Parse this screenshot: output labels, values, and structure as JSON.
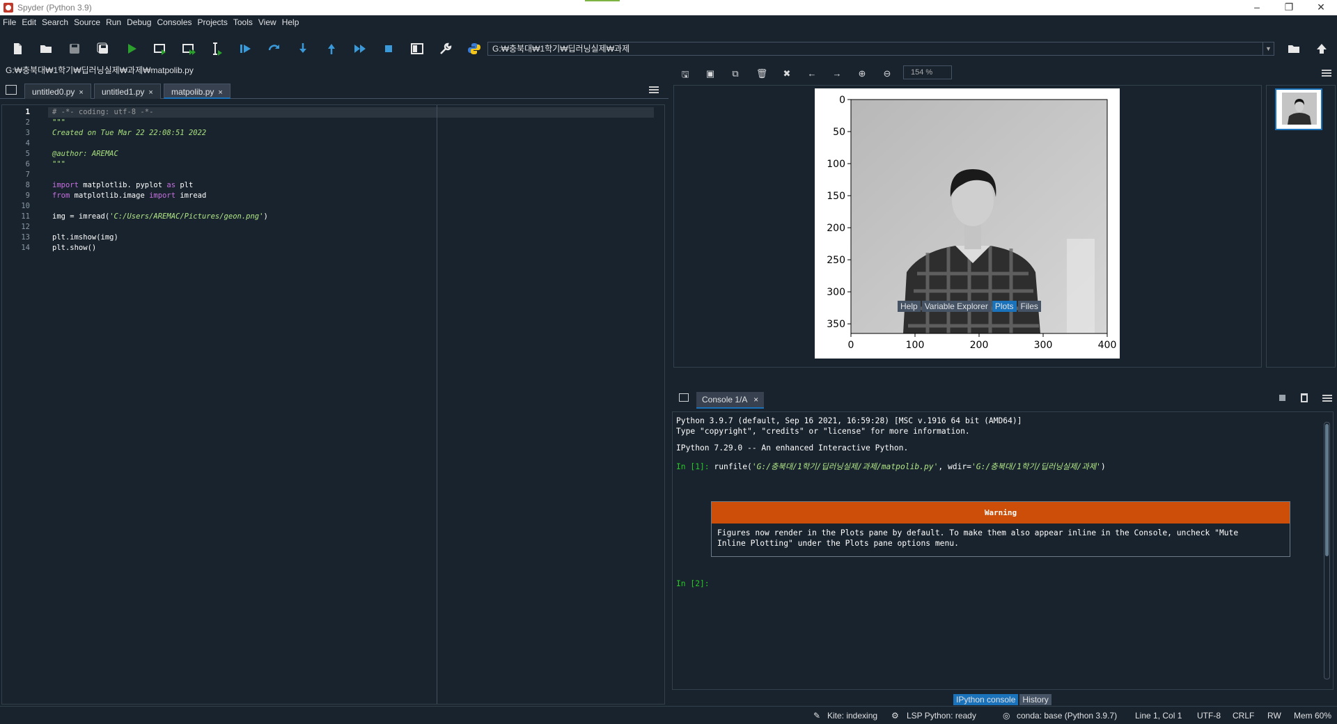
{
  "window": {
    "title": "Spyder (Python 3.9)"
  },
  "menu": [
    "File",
    "Edit",
    "Search",
    "Source",
    "Run",
    "Debug",
    "Consoles",
    "Projects",
    "Tools",
    "View",
    "Help"
  ],
  "toolbar": {
    "path": "G:₩충북대₩1학기₩딥러닝실제₩과제",
    "icons": [
      "new-file-icon",
      "open-file-icon",
      "save-icon",
      "save-all-icon",
      "run-icon",
      "run-cell-icon",
      "run-cell-advance-icon",
      "run-selection-icon",
      "debug-icon",
      "step-over-icon",
      "step-into-icon",
      "step-return-icon",
      "continue-icon",
      "stop-icon",
      "maximize-pane-icon",
      "preferences-icon",
      "python-path-icon"
    ]
  },
  "editor": {
    "filepath": "G:₩충북대₩1학기₩딥러닝실제₩과제₩matpolib.py",
    "tabs": [
      {
        "label": "untitled0.py",
        "close": "×"
      },
      {
        "label": "untitled1.py",
        "close": "×"
      },
      {
        "label": "matpolib.py",
        "close": "×"
      }
    ],
    "lines": [
      {
        "n": "1",
        "segs": [
          {
            "t": "# -*- coding: utf-8 -*-",
            "c": "cm"
          }
        ]
      },
      {
        "n": "2",
        "segs": [
          {
            "t": "\"\"\"",
            "c": "ds"
          }
        ]
      },
      {
        "n": "3",
        "segs": [
          {
            "t": "Created on Tue Mar 22 22:08:51 2022",
            "c": "ds"
          }
        ]
      },
      {
        "n": "4",
        "segs": []
      },
      {
        "n": "5",
        "segs": [
          {
            "t": "@author: AREMAC",
            "c": "ds"
          }
        ]
      },
      {
        "n": "6",
        "segs": [
          {
            "t": "\"\"\"",
            "c": "ds"
          }
        ]
      },
      {
        "n": "7",
        "segs": []
      },
      {
        "n": "8",
        "segs": [
          {
            "t": "import",
            "c": "kw"
          },
          {
            "t": " matplotlib. pyplot ",
            "c": ""
          },
          {
            "t": "as",
            "c": "kw"
          },
          {
            "t": " plt",
            "c": ""
          }
        ]
      },
      {
        "n": "9",
        "segs": [
          {
            "t": "from",
            "c": "kw"
          },
          {
            "t": " matplotlib.image ",
            "c": ""
          },
          {
            "t": "import",
            "c": "kw"
          },
          {
            "t": " imread",
            "c": ""
          }
        ]
      },
      {
        "n": "10",
        "segs": []
      },
      {
        "n": "11",
        "segs": [
          {
            "t": "img = imread(",
            "c": ""
          },
          {
            "t": "'C:/Users/AREMAC/Pictures/geon.png'",
            "c": "str"
          },
          {
            "t": ")",
            "c": ""
          }
        ]
      },
      {
        "n": "12",
        "segs": []
      },
      {
        "n": "13",
        "segs": [
          {
            "t": "plt.imshow(img)",
            "c": ""
          }
        ]
      },
      {
        "n": "14",
        "segs": [
          {
            "t": "plt.show()",
            "c": ""
          }
        ]
      }
    ]
  },
  "plots": {
    "zoom": "154 %",
    "x_ticks": [
      "0",
      "100",
      "200",
      "300",
      "400"
    ],
    "y_ticks": [
      "0",
      "50",
      "100",
      "150",
      "200",
      "250",
      "300",
      "350"
    ],
    "tabs": [
      "Help",
      "Variable Explorer",
      "Plots",
      "Files"
    ],
    "active_tab": "Plots"
  },
  "console": {
    "tab_label": "Console 1/A",
    "tab_close": "×",
    "line1": "Python 3.9.7 (default, Sep 16 2021, 16:59:28) [MSC v.1916 64 bit (AMD64)]",
    "line2": "Type \"copyright\", \"credits\" or \"license\" for more information.",
    "line3": "IPython 7.29.0 -- An enhanced Interactive Python.",
    "prompt1": "In [1]:",
    "cmd_a": " runfile(",
    "cmd_b": "'G:/충북대/1학기/딥러닝실제/과제/matpolib.py'",
    "cmd_c": ", wdir=",
    "cmd_d": "'G:/충북대/1학기/딥러닝실제/과제'",
    "cmd_e": ")",
    "warning_title": "Warning",
    "warning_text": "Figures now render in the Plots pane by default. To make them also appear inline in the Console, uncheck \"Mute\nInline Plotting\" under the Plots pane options menu.",
    "prompt2": "In [2]:",
    "tabs": [
      "IPython console",
      "History"
    ],
    "active_tab": "IPython console"
  },
  "status": {
    "kite": "Kite: indexing",
    "lsp": "LSP Python: ready",
    "conda": "conda: base (Python 3.9.7)",
    "position": "Line 1, Col 1",
    "encoding": "UTF-8",
    "eol": "CRLF",
    "rw": "RW",
    "mem": "Mem 60%"
  },
  "colors": {
    "accent": "#1a72bb",
    "background": "#19232d",
    "warning": "#cc4e08",
    "prompt": "#28c928"
  }
}
